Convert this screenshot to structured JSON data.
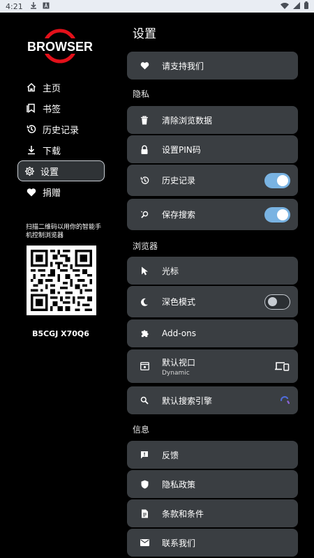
{
  "status_bar": {
    "time": "4:21",
    "icons": [
      "download-icon",
      "a-badge-icon",
      "wifi-icon",
      "signal-icon",
      "battery-icon"
    ]
  },
  "sidebar": {
    "logo_text": "BROWSER",
    "items": [
      {
        "label": "主页",
        "icon": "home-icon",
        "active": false
      },
      {
        "label": "书签",
        "icon": "bookmark-icon",
        "active": false
      },
      {
        "label": "历史记录",
        "icon": "history-icon",
        "active": false
      },
      {
        "label": "下载",
        "icon": "download-icon",
        "active": false
      },
      {
        "label": "设置",
        "icon": "gear-icon",
        "active": true
      },
      {
        "label": "捐赠",
        "icon": "heart-icon",
        "active": false
      }
    ],
    "qr_caption": "扫描二维码以用你的智能手机控制浏览器",
    "pair_code": "B5CGJ X70Q6"
  },
  "settings": {
    "title": "设置",
    "support": "请支持我们",
    "privacy_header": "隐私",
    "clear_data": "清除浏览数据",
    "set_pin": "设置PIN码",
    "history": "历史记录",
    "save_search": "保存搜索",
    "browser_header": "浏览器",
    "cursor": "光标",
    "dark_mode": "深色模式",
    "addons": "Add-ons",
    "default_viewport": "默认视口",
    "default_viewport_value": "Dynamic",
    "default_search": "默认搜索引擎",
    "info_header": "信息",
    "feedback": "反馈",
    "privacy_policy": "隐私政策",
    "terms": "条款和条件",
    "contact": "联系我们"
  },
  "toggles": {
    "history": true,
    "save_search": true,
    "dark_mode": false
  },
  "colors": {
    "background": "#000000",
    "card": "#3a3e42",
    "toggle_on": "#79b3e2",
    "logo_red": "#e3101a"
  }
}
